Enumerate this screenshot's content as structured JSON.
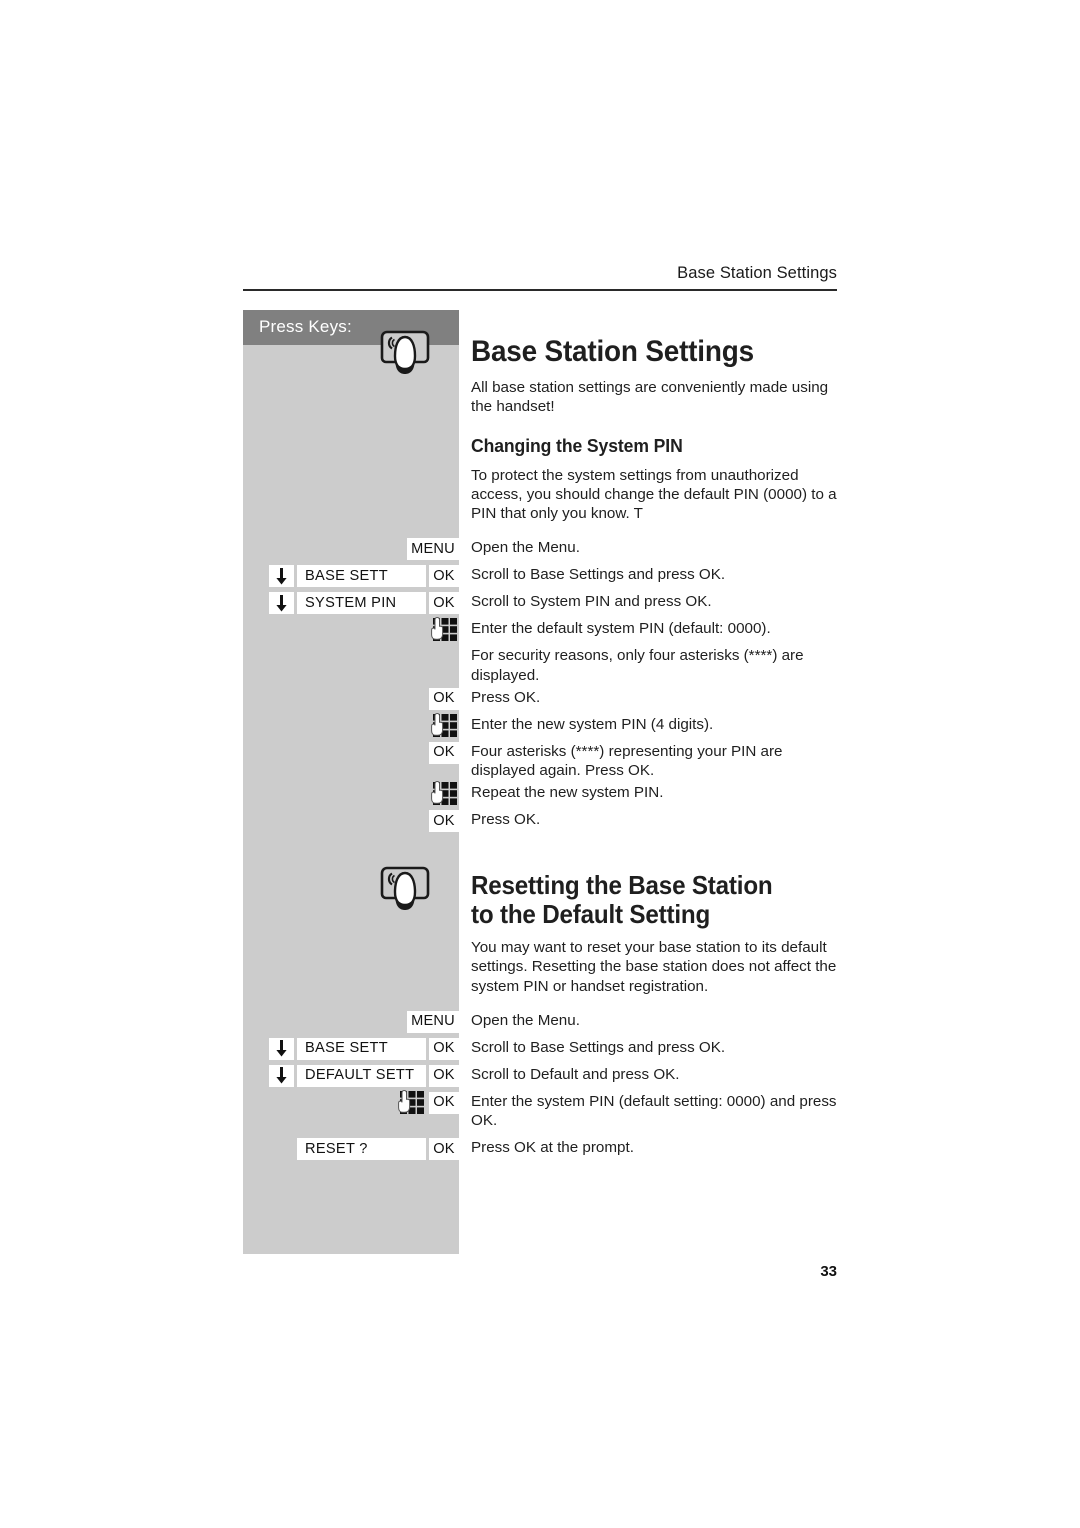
{
  "page": {
    "running_header": "Base Station Settings",
    "page_number": "33",
    "accent_gray": "#cccccc",
    "accent_header_gray": "#808080"
  },
  "keys_panel": {
    "title": "Press Keys:"
  },
  "sections": [
    {
      "heading": "Base Station Settings",
      "intro": "All base station settings are conveniently made using the handset!",
      "subheading": "Changing the System PIN",
      "subintro": "To protect the system settings from unauthorized access, you should change the default PIN (0000) to a PIN that only you know. T",
      "icon": "base-station-icon",
      "steps": [
        {
          "keys": [
            {
              "type": "menu",
              "label": "MENU"
            }
          ],
          "text": "Open the Menu."
        },
        {
          "keys": [
            {
              "type": "arrow"
            },
            {
              "type": "label",
              "label": "BASE SETT"
            },
            {
              "type": "ok",
              "label": "OK"
            }
          ],
          "text": "Scroll to Base Settings and press OK."
        },
        {
          "keys": [
            {
              "type": "arrow"
            },
            {
              "type": "label",
              "label": "SYSTEM PIN"
            },
            {
              "type": "ok",
              "label": "OK"
            }
          ],
          "text": "Scroll to System PIN and press OK."
        },
        {
          "keys": [
            {
              "type": "keypad"
            }
          ],
          "text": "Enter the default system PIN (default: 0000)."
        },
        {
          "keys": [],
          "text": "For security reasons, only four asterisks (****) are displayed."
        },
        {
          "keys": [
            {
              "type": "ok",
              "label": "OK"
            }
          ],
          "text": "Press OK."
        },
        {
          "keys": [
            {
              "type": "keypad"
            }
          ],
          "text": "Enter the new system PIN (4 digits)."
        },
        {
          "keys": [
            {
              "type": "ok",
              "label": "OK"
            }
          ],
          "text": "Four asterisks (****) representing your PIN are displayed again. Press OK."
        },
        {
          "keys": [
            {
              "type": "keypad"
            }
          ],
          "text": "Repeat the new system PIN."
        },
        {
          "keys": [
            {
              "type": "ok",
              "label": "OK"
            }
          ],
          "text": "Press OK."
        }
      ]
    },
    {
      "heading": "Resetting the Base Station to the Default Setting",
      "heading_line1": "Resetting the Base Station",
      "heading_line2": "to the Default Setting",
      "intro": "You may want to reset your base station to its default settings. Resetting the base station does not affect the system PIN or handset registration.",
      "icon": "base-station-icon",
      "steps": [
        {
          "keys": [
            {
              "type": "menu",
              "label": "MENU"
            }
          ],
          "text": "Open the Menu."
        },
        {
          "keys": [
            {
              "type": "arrow"
            },
            {
              "type": "label",
              "label": "BASE SETT"
            },
            {
              "type": "ok",
              "label": "OK"
            }
          ],
          "text": "Scroll to Base Settings and press OK."
        },
        {
          "keys": [
            {
              "type": "arrow"
            },
            {
              "type": "label",
              "label": "DEFAULT SETT"
            },
            {
              "type": "ok",
              "label": "OK"
            }
          ],
          "text": "Scroll to Default and press OK."
        },
        {
          "keys": [
            {
              "type": "keypad"
            },
            {
              "type": "ok",
              "label": "OK"
            }
          ],
          "text": "Enter the system PIN (default setting: 0000) and press OK."
        },
        {
          "keys": [
            {
              "type": "label",
              "label": "RESET ?"
            },
            {
              "type": "ok",
              "label": "OK"
            }
          ],
          "text": "Press OK at the prompt."
        }
      ]
    }
  ]
}
